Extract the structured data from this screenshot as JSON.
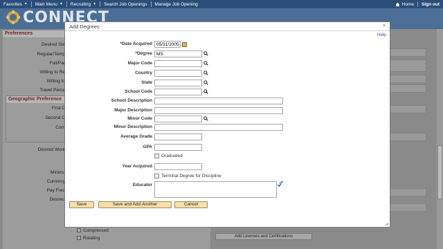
{
  "topnav": {
    "favorites": "Favorites",
    "main_menu": "Main Menu",
    "recruiting": "Recruiting",
    "search_job_openings": "Search Job Openings",
    "manage_job_opening": "Manage Job Opening",
    "home": "Home",
    "sign_out": "Sign out"
  },
  "header": {
    "logo_text": "CONNECT"
  },
  "background": {
    "preferences_title": "Preferences",
    "labels": [
      "Desired Sta",
      "Regular/Temp",
      "Full/Par",
      "Willing to Re",
      "Willing to",
      "Travel Perce"
    ],
    "geo_title": "Geographic Preference",
    "geo_labels": [
      "First C",
      "Second C",
      "Com"
    ],
    "lower_labels": [
      "Desired Work",
      "Minimu",
      "Currency",
      "Pay Freq",
      "Desired"
    ],
    "compressed": "Compressed",
    "rotating": "Rotating",
    "add_licenses": "Add Licenses and Certifications"
  },
  "modal": {
    "title": "Add Degrees",
    "help": "Help",
    "fields": {
      "date_acquired": {
        "label": "*Date Acquired",
        "value": "05/31/2005"
      },
      "degree": {
        "label": "*Degree",
        "value": "MS"
      },
      "major_code": {
        "label": "Major Code",
        "value": ""
      },
      "country": {
        "label": "Country",
        "value": ""
      },
      "state": {
        "label": "State",
        "value": ""
      },
      "school_code": {
        "label": "School Code",
        "value": ""
      },
      "school_description": {
        "label": "School Description",
        "value": ""
      },
      "major_description": {
        "label": "Major Description",
        "value": ""
      },
      "minor_code": {
        "label": "Minor Code",
        "value": ""
      },
      "minor_description": {
        "label": "Minor Description",
        "value": ""
      },
      "average_grade": {
        "label": "Average Grade",
        "value": ""
      },
      "gpa": {
        "label": "GPA",
        "value": ""
      },
      "graduated": {
        "label": "Graduated",
        "checked": false
      },
      "year_acquired": {
        "label": "Year Acquired",
        "value": ""
      },
      "terminal_degree": {
        "label": "Terminal Degree for Discipline",
        "checked": false
      },
      "educator": {
        "label": "Educator",
        "value": ""
      }
    },
    "buttons": {
      "save": "Save",
      "save_add_another": "Save and Add Another",
      "cancel": "Cancel"
    }
  },
  "colors": {
    "nav_bg": "#2a4e78",
    "header_bg": "#4a6e96",
    "button_bg": "#f5dfae",
    "section_title": "#7a2424",
    "link": "#2553a3"
  }
}
